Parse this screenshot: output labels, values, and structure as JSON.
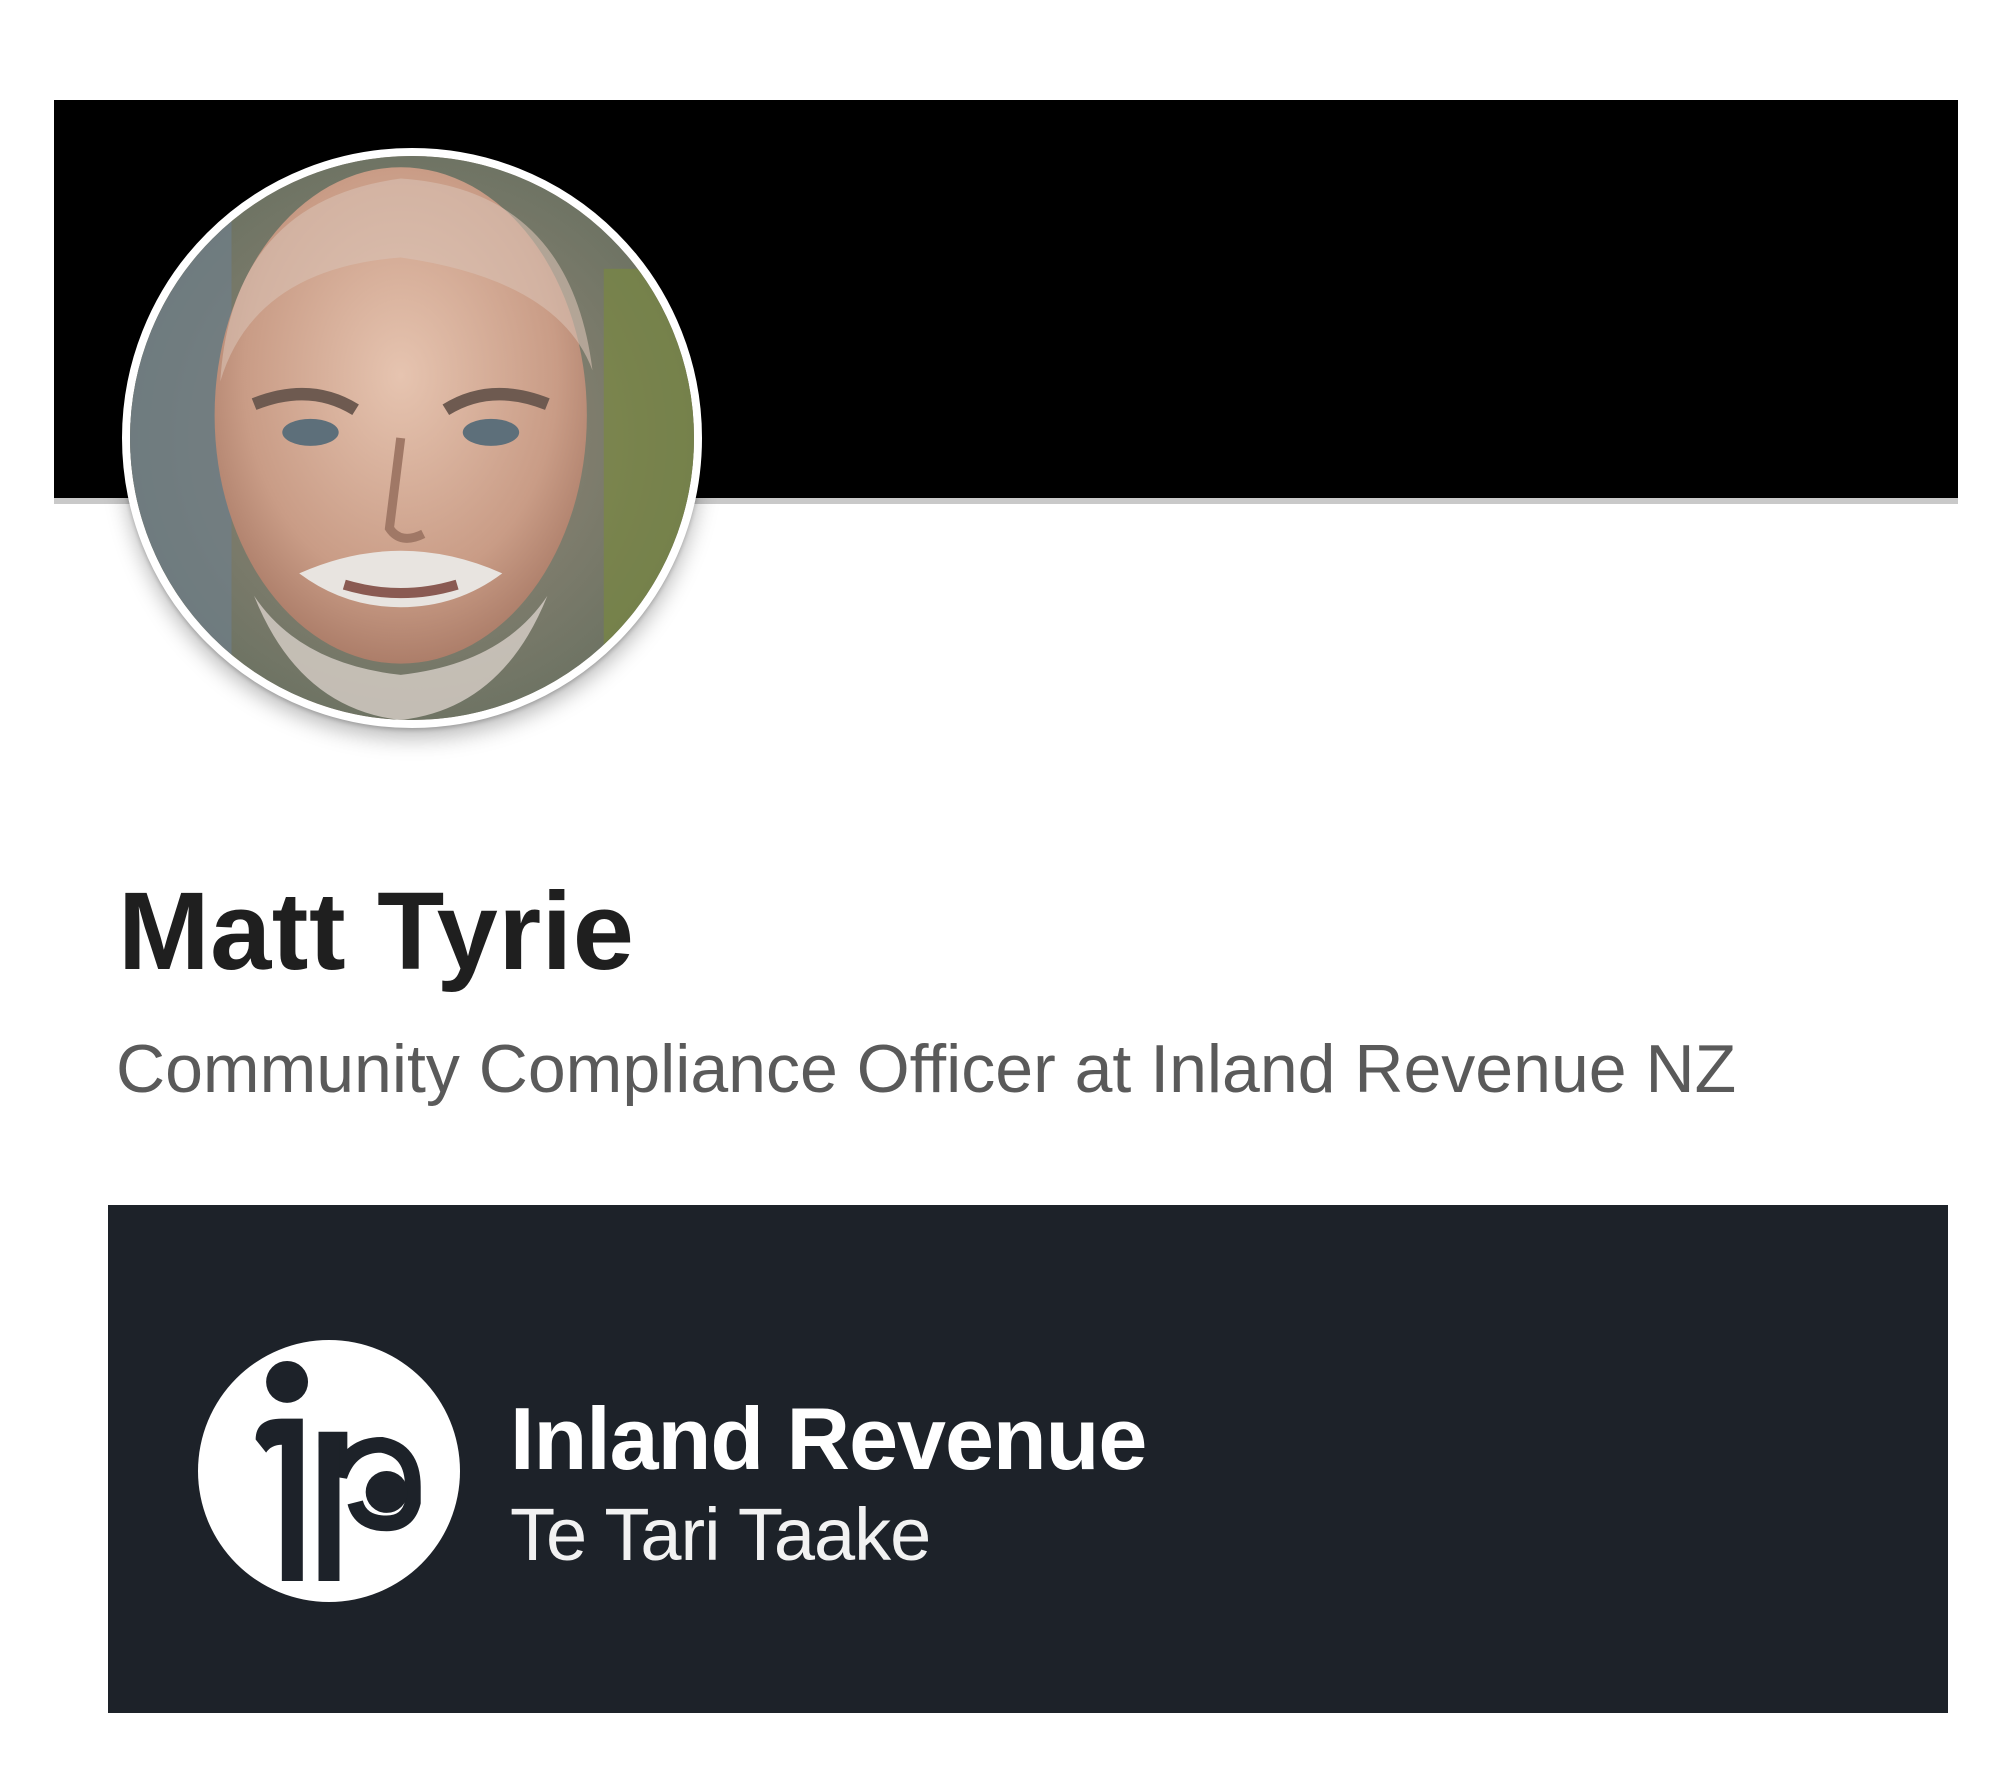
{
  "profile": {
    "name": "Matt Tyrie",
    "headline": "Community Compliance Officer at Inland Revenue NZ",
    "avatar_icon": "profile-photo"
  },
  "company": {
    "name": "Inland Revenue",
    "subname": "Te Tari Taake",
    "logo_icon": "ir-logo-icon"
  },
  "colors": {
    "banner": "#000000",
    "card_background": "#1d2229",
    "name_text": "#1f1f1f",
    "headline_text": "#5a5a5a"
  }
}
